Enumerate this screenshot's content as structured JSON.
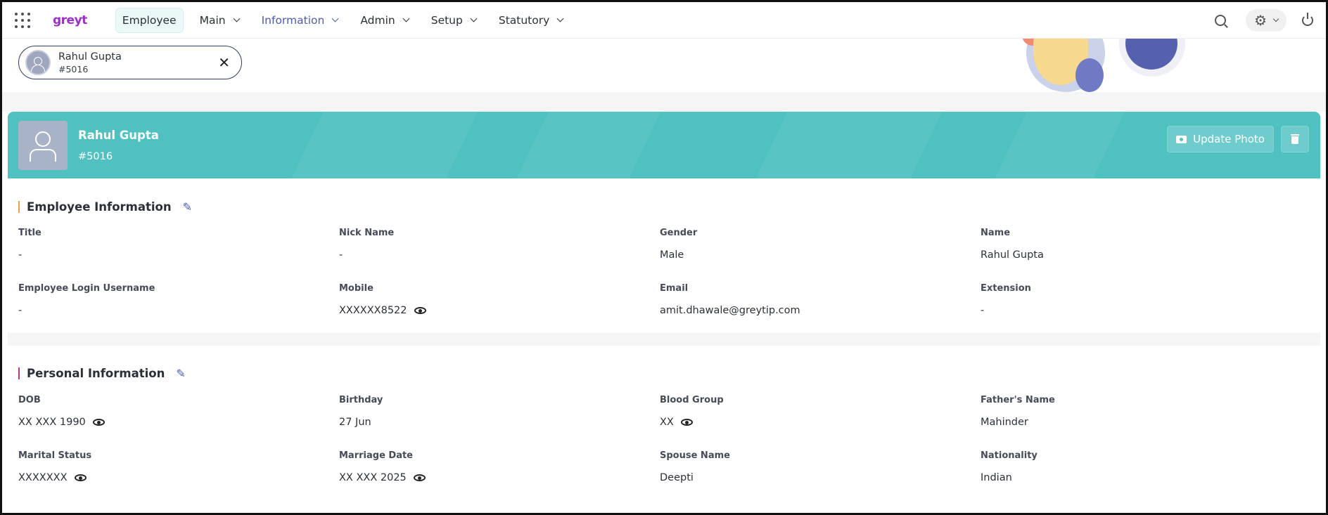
{
  "nav": {
    "logo": "greyt",
    "items": [
      {
        "label": "Employee"
      },
      {
        "label": "Main"
      },
      {
        "label": "Information"
      },
      {
        "label": "Admin"
      },
      {
        "label": "Setup"
      },
      {
        "label": "Statutory"
      }
    ],
    "icons": [
      "apps-grid-icon",
      "search-icon",
      "gear-icon",
      "power-icon"
    ]
  },
  "selected_employee": {
    "name": "Rahul Gupta",
    "id": "#5016"
  },
  "banner": {
    "name": "Rahul Gupta",
    "id": "#5016",
    "update_photo_label": "Update Photo",
    "color": "#4fc1c1"
  },
  "employee_info": {
    "title": "Employee Information",
    "accent": "#f0a04b",
    "fields": [
      {
        "label": "Title",
        "value": "-"
      },
      {
        "label": "Nick Name",
        "value": "-"
      },
      {
        "label": "Gender",
        "value": "Male"
      },
      {
        "label": "Name",
        "value": "Rahul Gupta"
      },
      {
        "label": "Employee Login Username",
        "value": "-"
      },
      {
        "label": "Mobile",
        "value": "XXXXXX8522"
      },
      {
        "label": "Email",
        "value": "amit.dhawale@greytip.com"
      },
      {
        "label": "Extension",
        "value": "-"
      }
    ]
  },
  "personal_info": {
    "title": "Personal Information",
    "accent": "#b03b8a",
    "fields": [
      {
        "label": "DOB",
        "value": "XX XXX 1990"
      },
      {
        "label": "Birthday",
        "value": "27 Jun"
      },
      {
        "label": "Blood Group",
        "value": "XX"
      },
      {
        "label": "Father's Name",
        "value": "Mahinder"
      },
      {
        "label": "Marital Status",
        "value": "XXXXXXX"
      },
      {
        "label": "Marriage Date",
        "value": "XX XXX 2025"
      },
      {
        "label": "Spouse Name",
        "value": "Deepti"
      },
      {
        "label": "Nationality",
        "value": "Indian"
      }
    ]
  }
}
